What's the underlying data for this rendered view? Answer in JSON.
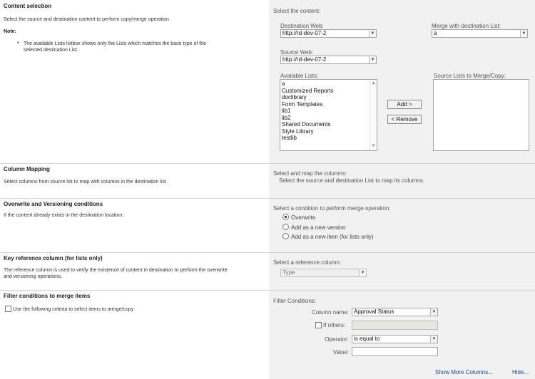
{
  "content_selection": {
    "heading": "Content selection",
    "description": "Select the source and destination content to perform copy/merge operation",
    "note_label": "Note:",
    "note_bullet": "The available Lists listbox shows only the Lists which matches the base type of the selected destination List.",
    "right_title": "Select the content:",
    "destination_web": {
      "label": "Destination Web:",
      "value": "http://rd-dev-07-2"
    },
    "merge_with": {
      "label": "Merge with destination List:",
      "value": "a"
    },
    "source_web": {
      "label": "Source Web:",
      "value": "http://rd-dev-07-2"
    },
    "available_lists": {
      "label": "Available Lists:",
      "items": [
        "a",
        "Customized Reports",
        "doclibrary",
        "Form Templates",
        "lib1",
        "lib2",
        "Shared Documents",
        "Style Library",
        "testlib"
      ]
    },
    "source_lists": {
      "label": "Source Lists to Merge/Copy:"
    },
    "add_button": "Add >",
    "remove_button": "< Remove"
  },
  "column_mapping": {
    "heading": "Column Mapping",
    "description": "Select columns from source list to map with columns in the destination list",
    "right_title": "Select and map the columns:",
    "right_sub": "Select the source and destination List to map its columns."
  },
  "overwrite": {
    "heading": "Overwrite and Versioning conditions",
    "description": "If the content already exists in the destination location:",
    "right_title": "Select a condition to perform merge operation:",
    "options": [
      "Overwrite",
      "Add as a new version",
      "Add as a new item (for lists only)"
    ],
    "selected_index": 0
  },
  "key_reference": {
    "heading": "Key reference column (for lists only)",
    "description": "The reference column is used to verify the existence of content in destination to perform the overwrite and versioning operations.",
    "right_title": "Select a reference column:",
    "select_value": "Type"
  },
  "filter": {
    "heading": "Filter conditions to merge items",
    "checkbox_label": "Use the following criteria to select items to merge/copy",
    "right_title": "Filter Conditions:",
    "column_name": {
      "label": "Column name:",
      "value": "Approval Status"
    },
    "if_others": {
      "label": "If others:",
      "value": ""
    },
    "operator": {
      "label": "Operator:",
      "value": "is equal to"
    },
    "value": {
      "label": "Value:",
      "value": ""
    },
    "show_more": "Show More Columns...",
    "hide": "Hide..."
  }
}
